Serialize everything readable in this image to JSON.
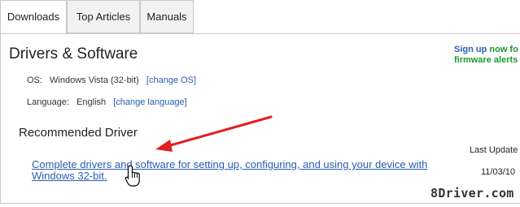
{
  "tabs": [
    {
      "label": "Downloads",
      "active": true
    },
    {
      "label": "Top Articles",
      "active": false
    },
    {
      "label": "Manuals",
      "active": false
    }
  ],
  "section": {
    "title": "Drivers & Software",
    "os_label": "OS:",
    "os_value": "Windows Vista (32-bit)",
    "os_change_link": "[change OS]",
    "language_label": "Language:",
    "language_value": "English",
    "language_change_link": "[change language]"
  },
  "recommended": {
    "title": "Recommended Driver",
    "driver_link": "Complete drivers and software for setting up, configuring, and using your device with Windows 32-bit.",
    "last_update_label": "Last Update",
    "last_update_date": "11/03/10"
  },
  "signup": {
    "line1_link": "Sign up",
    "line1_rest": " now fo",
    "line2": "firmware alerts"
  },
  "watermark": "8Driver.com",
  "colors": {
    "link": "#2a5db0",
    "signup_green": "#1a9a2f",
    "arrow_red": "#e02020"
  },
  "icons": [
    "arrow-annotation",
    "hand-cursor-icon"
  ]
}
